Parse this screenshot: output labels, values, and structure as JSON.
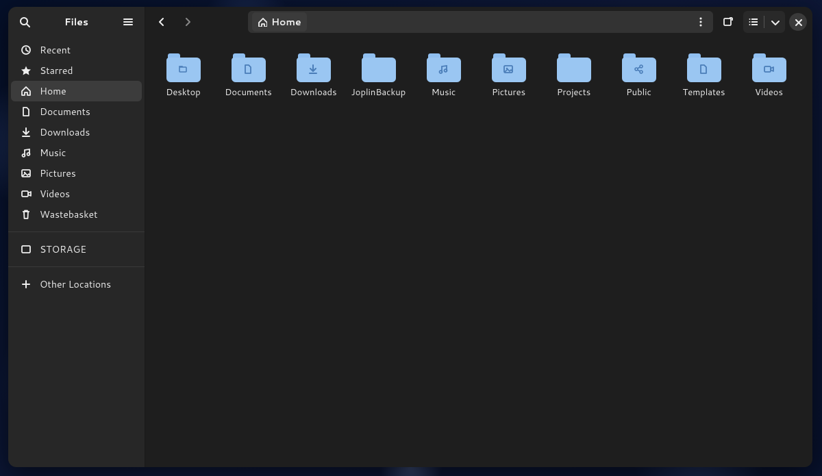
{
  "app_title": "Files",
  "pathbar": {
    "segments": [
      {
        "label": "Home",
        "icon": "home"
      }
    ]
  },
  "sidebar": {
    "items": [
      {
        "label": "Recent",
        "icon": "clock"
      },
      {
        "label": "Starred",
        "icon": "star"
      },
      {
        "label": "Home",
        "icon": "home",
        "active": true
      },
      {
        "label": "Documents",
        "icon": "document"
      },
      {
        "label": "Downloads",
        "icon": "download"
      },
      {
        "label": "Music",
        "icon": "music"
      },
      {
        "label": "Pictures",
        "icon": "picture"
      },
      {
        "label": "Videos",
        "icon": "video"
      },
      {
        "label": "Wastebasket",
        "icon": "trash"
      }
    ],
    "mounts": [
      {
        "label": "STORAGE",
        "icon": "drive"
      }
    ],
    "other": {
      "label": "Other Locations",
      "icon": "plus"
    }
  },
  "folders": [
    {
      "name": "Desktop",
      "glyph": "folder-generic"
    },
    {
      "name": "Documents",
      "glyph": "document"
    },
    {
      "name": "Downloads",
      "glyph": "download"
    },
    {
      "name": "JoplinBackup",
      "glyph": "none"
    },
    {
      "name": "Music",
      "glyph": "music"
    },
    {
      "name": "Pictures",
      "glyph": "picture"
    },
    {
      "name": "Projects",
      "glyph": "none"
    },
    {
      "name": "Public",
      "glyph": "share"
    },
    {
      "name": "Templates",
      "glyph": "document"
    },
    {
      "name": "Videos",
      "glyph": "video"
    }
  ],
  "colors": {
    "folder_fill": "#9ac6f2",
    "folder_tab": "#90bff0",
    "folder_glyph": "#4a7db8"
  }
}
